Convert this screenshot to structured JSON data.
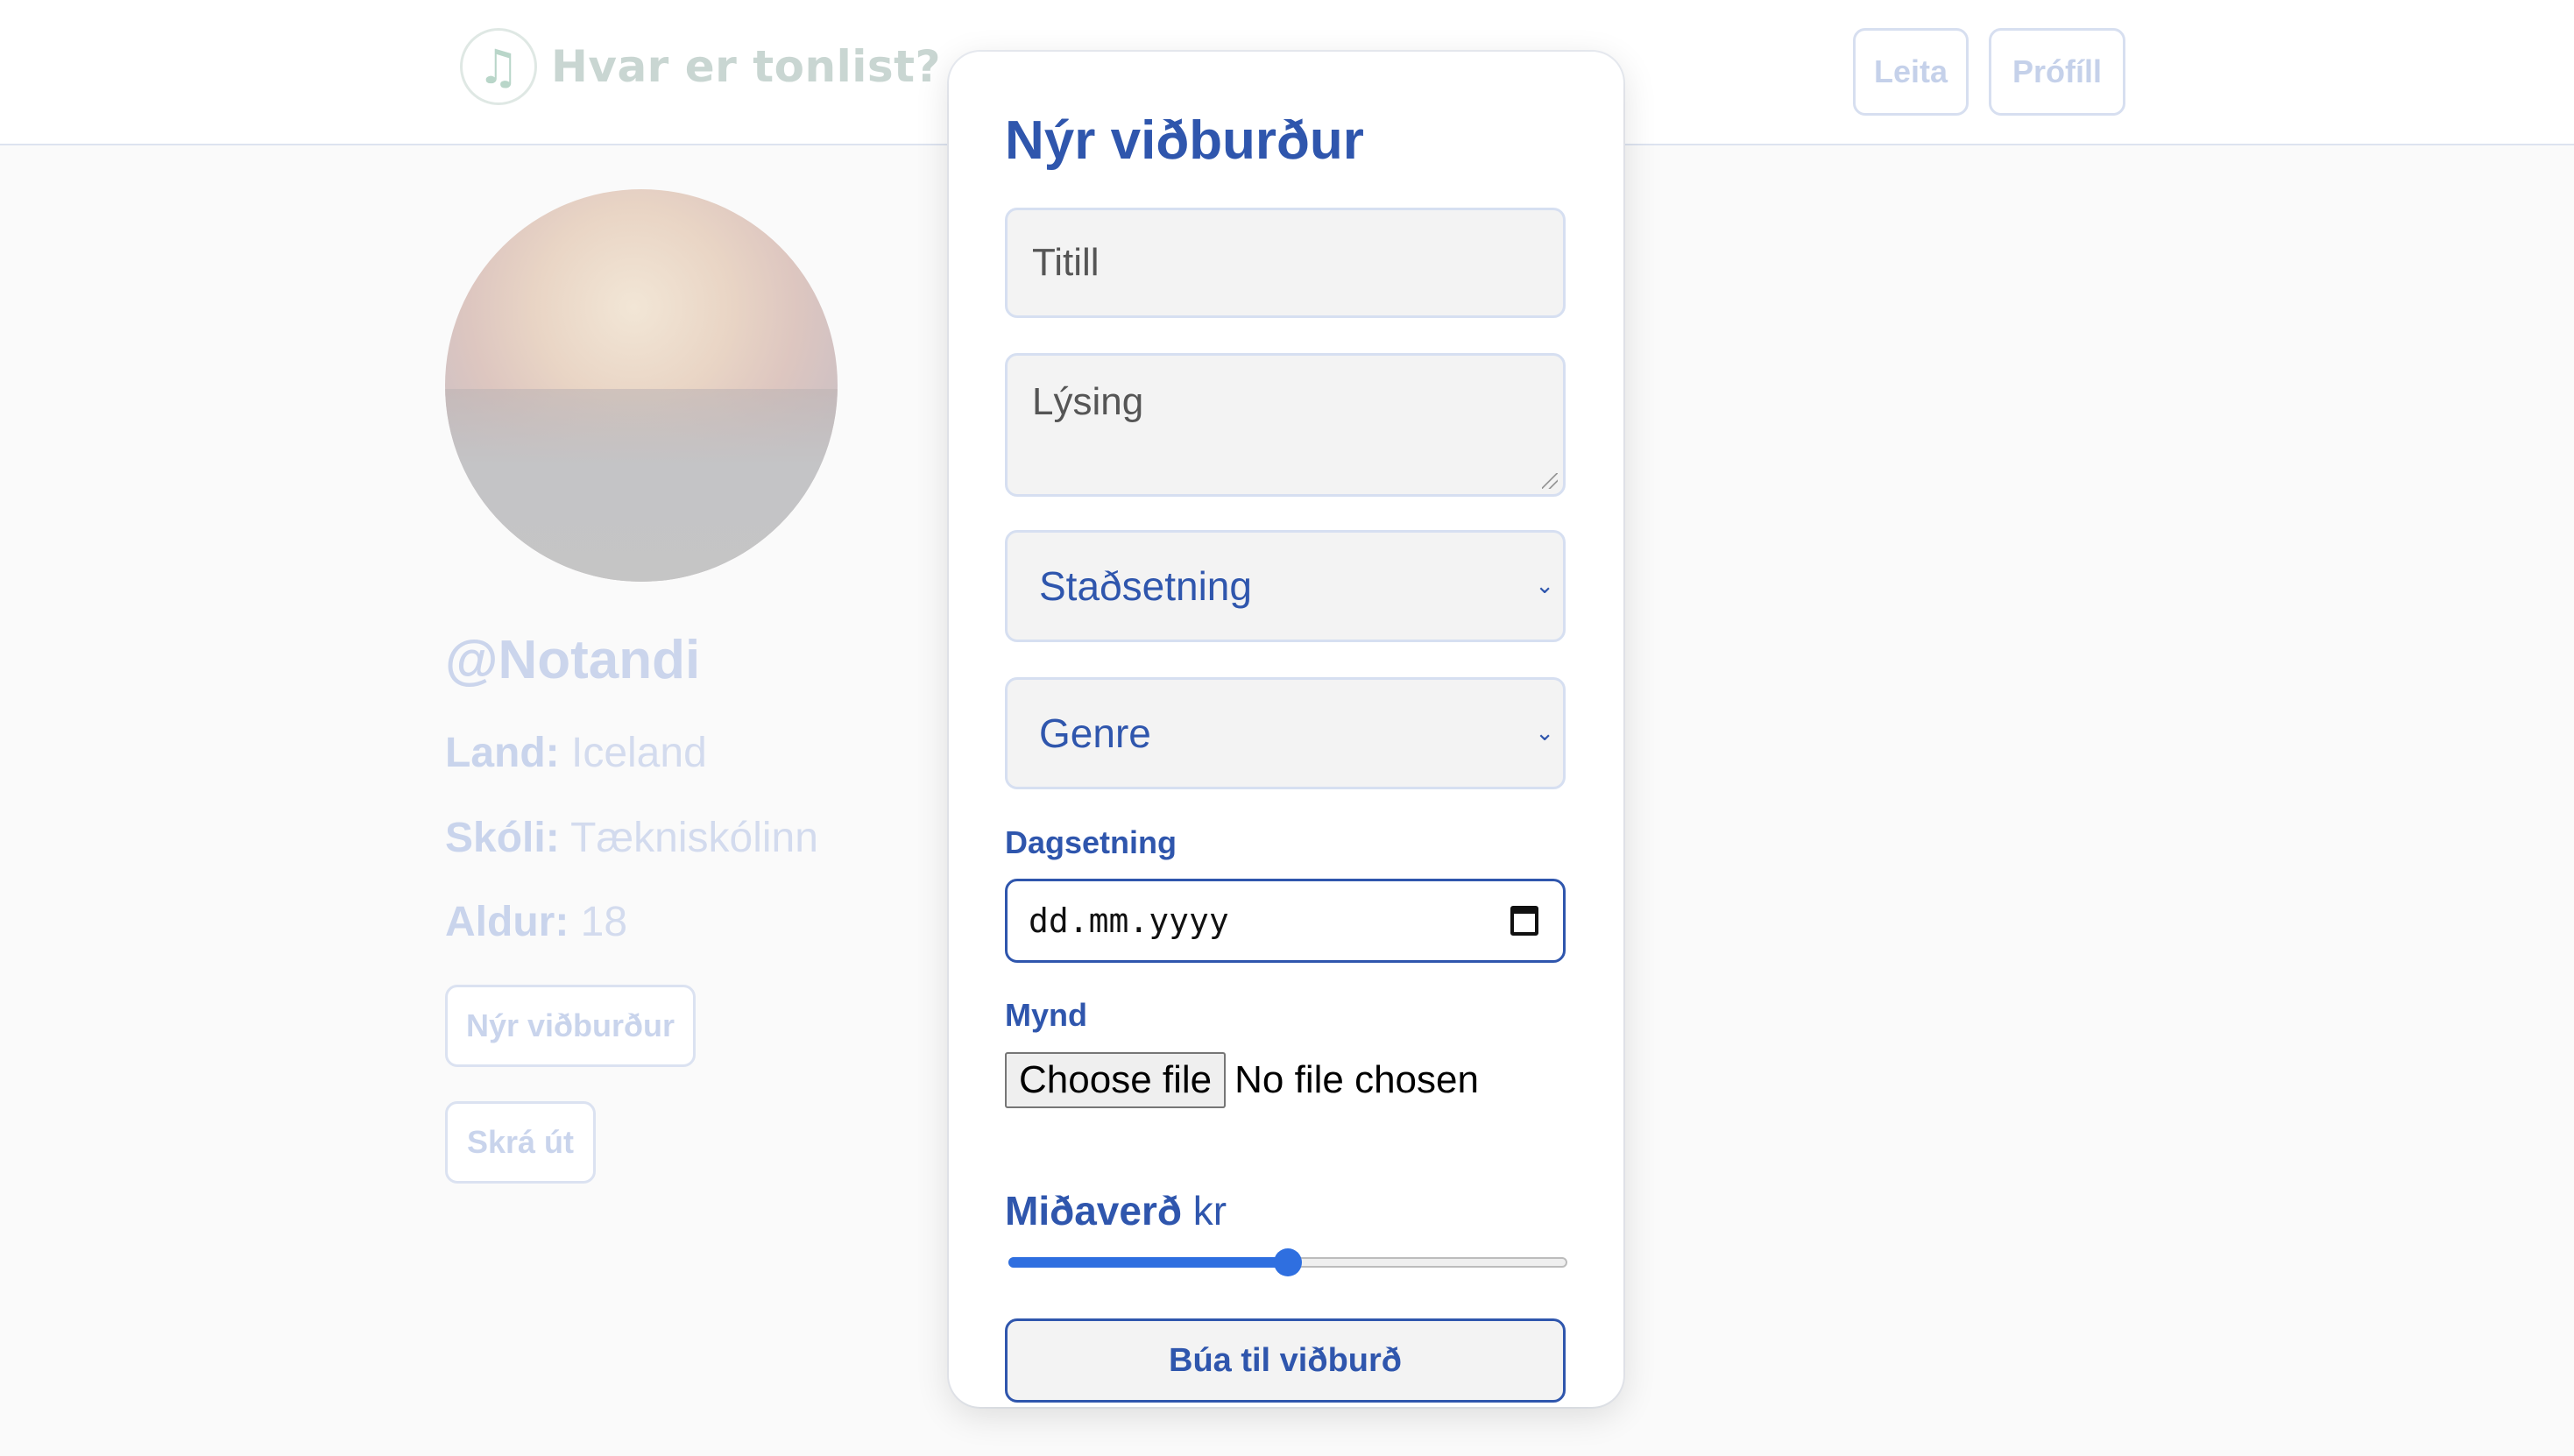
{
  "header": {
    "brand_icon": "music-note-icon",
    "brand_title": "Hvar er tonlist?",
    "nav": {
      "search_label": "Leita",
      "profile_label": "Prófíll"
    }
  },
  "profile": {
    "username": "@Notandi",
    "land_label": "Land:",
    "land_value": "Iceland",
    "school_label": "Skóli:",
    "school_value": "Tækniskólinn",
    "age_label": "Aldur:",
    "age_value": "18",
    "new_event_label": "Nýr viðburður",
    "logout_label": "Skrá út"
  },
  "modal": {
    "title": "Nýr viðburður",
    "title_placeholder": "Titill",
    "description_placeholder": "Lýsing",
    "location_select": "Staðsetning",
    "genre_select": "Genre",
    "date_label": "Dagsetning",
    "date_placeholder": "dd.mm.yyyy",
    "image_label": "Mynd",
    "file_button": "Choose file",
    "file_status": "No file chosen",
    "price_label": "Miðaverð",
    "price_unit": "kr",
    "price_slider_fraction": 0.5,
    "submit_label": "Búa til viðburð"
  },
  "colors": {
    "accent": "#2f56ad",
    "slider": "#2f6fe0"
  }
}
